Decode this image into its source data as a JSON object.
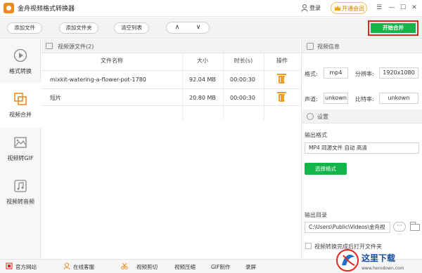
{
  "app": {
    "title": "金舟视频格式转换器"
  },
  "titlebar": {
    "login_label": "登录",
    "vip_label": "开通会员",
    "win_controls": [
      "☰",
      "—",
      "☐",
      "✕"
    ]
  },
  "toolbar": {
    "add_file": "添加文件",
    "add_folder": "添加文件夹",
    "clear_list": "清空列表",
    "move_up": "∧",
    "move_down": "∨",
    "start_merge": "开始合并"
  },
  "sidebar": {
    "items": [
      {
        "label": "格式转换",
        "active": false
      },
      {
        "label": "视频合并",
        "active": true
      },
      {
        "label": "视频转GIF",
        "active": false
      },
      {
        "label": "视频转音频",
        "active": false
      }
    ]
  },
  "file_list": {
    "header": "视频源文件(2)",
    "columns": [
      "文件名称",
      "大小",
      "时长(s)",
      "操作"
    ],
    "rows": [
      {
        "name": "mixkit-watering-a-flower-pot-1780",
        "size": "92.04 MB",
        "duration": "00:00:30"
      },
      {
        "name": "短片",
        "size": "20.80 MB",
        "duration": "00:00:30"
      }
    ]
  },
  "video_info": {
    "header": "视频信息",
    "format_label": "格式:",
    "format_value": "mp4",
    "resolution_label": "分辨率:",
    "resolution_value": "1920x1080",
    "audio_label": "声道:",
    "audio_value": "unkown",
    "bitrate_label": "比特率:",
    "bitrate_value": "unkown"
  },
  "settings": {
    "header": "设置",
    "output_format_label": "输出格式",
    "output_format_value": "MP4 同源文件 自动 高清",
    "select_format_button": "选择格式",
    "output_dir_label": "输出目录",
    "output_dir_value": "C:\\Users\\Public\\Videos\\金舟视",
    "more_button": "···",
    "checkbox_label": "视频转换完成后打开文件夹"
  },
  "footer": {
    "items": [
      "官方网站",
      "在线客服",
      "视频剪切",
      "视频压缩",
      "GIF制作",
      "录屏"
    ]
  },
  "watermark": {
    "text": "这里下载",
    "url_text": "www.herodown.com"
  },
  "colors": {
    "accent_green": "#13b54a",
    "highlight_red": "#e0271f",
    "orange": "#f08a1c"
  }
}
